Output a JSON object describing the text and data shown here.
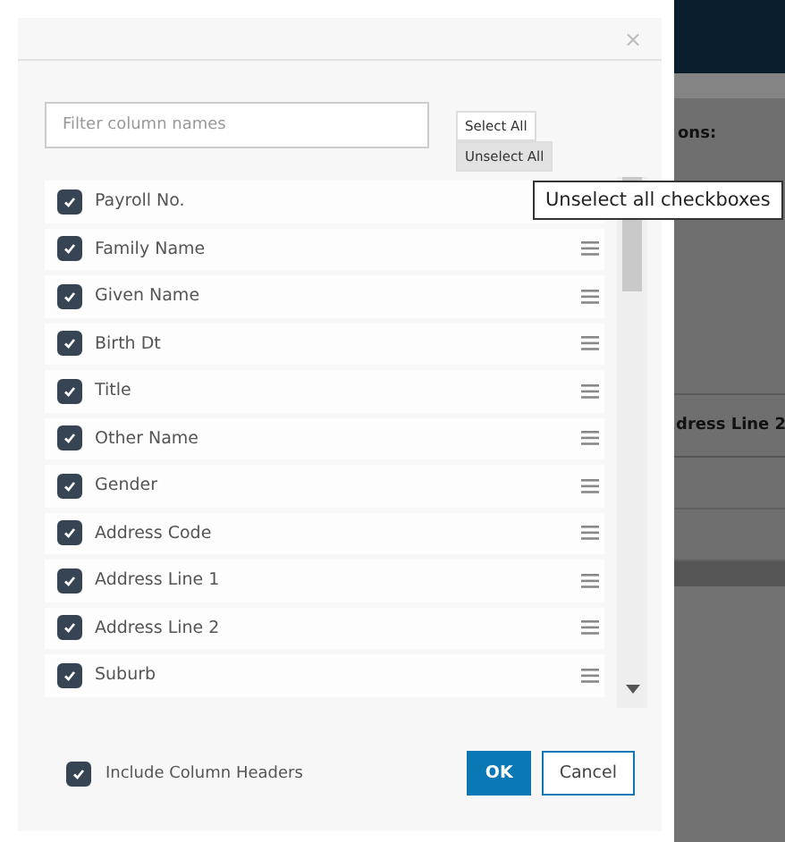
{
  "dialog": {
    "close": "×",
    "filter": {
      "placeholder": "Filter column names"
    },
    "select_all": "Select All",
    "unselect_all": "Unselect All",
    "columns": [
      {
        "label": "Payroll No.",
        "checked": true,
        "drag_handle": false
      },
      {
        "label": "Family Name",
        "checked": true,
        "drag_handle": true
      },
      {
        "label": "Given Name",
        "checked": true,
        "drag_handle": true
      },
      {
        "label": "Birth Dt",
        "checked": true,
        "drag_handle": true
      },
      {
        "label": "Title",
        "checked": true,
        "drag_handle": true
      },
      {
        "label": "Other Name",
        "checked": true,
        "drag_handle": true
      },
      {
        "label": "Gender",
        "checked": true,
        "drag_handle": true
      },
      {
        "label": "Address Code",
        "checked": true,
        "drag_handle": true
      },
      {
        "label": "Address Line 1",
        "checked": true,
        "drag_handle": true
      },
      {
        "label": "Address Line 2",
        "checked": true,
        "drag_handle": true
      },
      {
        "label": "Suburb",
        "checked": true,
        "drag_handle": true
      }
    ],
    "include_headers": {
      "label": "Include Column Headers",
      "checked": true
    },
    "buttons": [
      {
        "label": "OK",
        "kind": "primary"
      },
      {
        "label": "Cancel",
        "kind": "secondary"
      }
    ]
  },
  "tooltip": "Unselect all checkboxes",
  "background": {
    "label": "ons:",
    "column_header": "dress Line 2"
  }
}
